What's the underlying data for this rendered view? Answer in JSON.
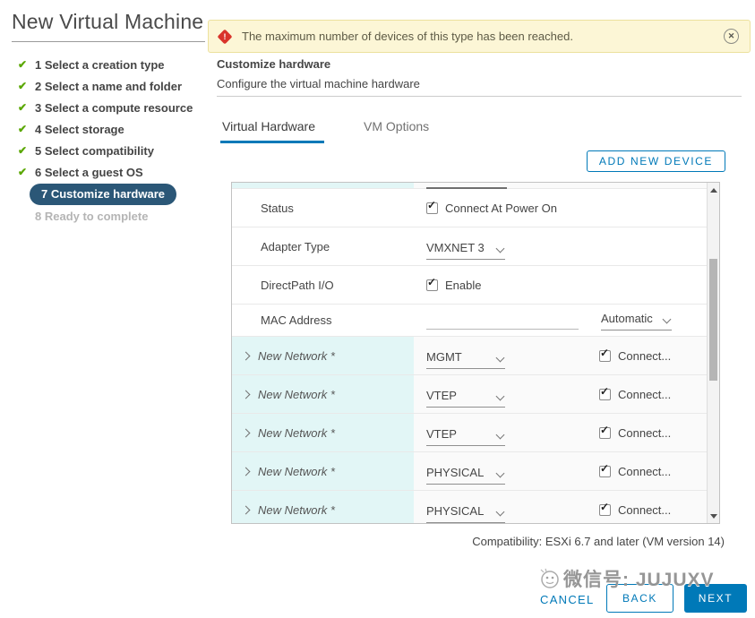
{
  "window": {
    "title": "New Virtual Machine"
  },
  "banner": {
    "message": "The maximum number of devices of this type has been reached.",
    "warning_glyph": "!",
    "close_glyph": "✕"
  },
  "steps": {
    "check_glyph": "✔",
    "items": [
      {
        "label": "1 Select a creation type",
        "state": "done"
      },
      {
        "label": "2 Select a name and folder",
        "state": "done"
      },
      {
        "label": "3 Select a compute resource",
        "state": "done"
      },
      {
        "label": "4 Select storage",
        "state": "done"
      },
      {
        "label": "5 Select compatibility",
        "state": "done"
      },
      {
        "label": "6 Select a guest OS",
        "state": "done"
      },
      {
        "label": "7 Customize hardware",
        "state": "active"
      },
      {
        "label": "8 Ready to complete",
        "state": "pending"
      }
    ]
  },
  "panel": {
    "title": "Customize hardware",
    "subtitle": "Configure the virtual machine hardware",
    "tabs": [
      {
        "label": "Virtual Hardware",
        "active": true
      },
      {
        "label": "VM Options",
        "active": false
      }
    ],
    "add_device_label": "ADD NEW DEVICE"
  },
  "hardware": {
    "check_glyph": "✓",
    "rows": {
      "status": {
        "label": "Status",
        "checkbox_label": "Connect At Power On",
        "checked": true
      },
      "adapter": {
        "label": "Adapter Type",
        "value": "VMXNET 3"
      },
      "directpath": {
        "label": "DirectPath I/O",
        "checkbox_label": "Enable",
        "checked": true
      },
      "mac": {
        "label": "MAC Address",
        "value": "",
        "mode": "Automatic"
      }
    },
    "network_rows": [
      {
        "label": "New Network *",
        "value": "MGMT",
        "connect_label": "Connect...",
        "checked": true
      },
      {
        "label": "New Network *",
        "value": "VTEP",
        "connect_label": "Connect...",
        "checked": true
      },
      {
        "label": "New Network *",
        "value": "VTEP",
        "connect_label": "Connect...",
        "checked": true
      },
      {
        "label": "New Network *",
        "value": "PHYSICAL",
        "connect_label": "Connect...",
        "checked": true
      },
      {
        "label": "New Network *",
        "value": "PHYSICAL",
        "connect_label": "Connect...",
        "checked": true
      }
    ]
  },
  "footer": {
    "compatibility": "Compatibility: ESXi 6.7 and later (VM version 14)",
    "cancel_label": "CANCEL",
    "back_label": "BACK",
    "next_label": "NEXT"
  },
  "watermark": {
    "text": "微信号: JUJUXV"
  },
  "colors": {
    "accent": "#0079b8",
    "warning_bg": "#fcf6d6",
    "warning_icon_red": "#d9342b",
    "active_step_bg": "#2b5777",
    "network_row_bg": "#e2f6f6",
    "step_check_green": "#5aa700"
  }
}
